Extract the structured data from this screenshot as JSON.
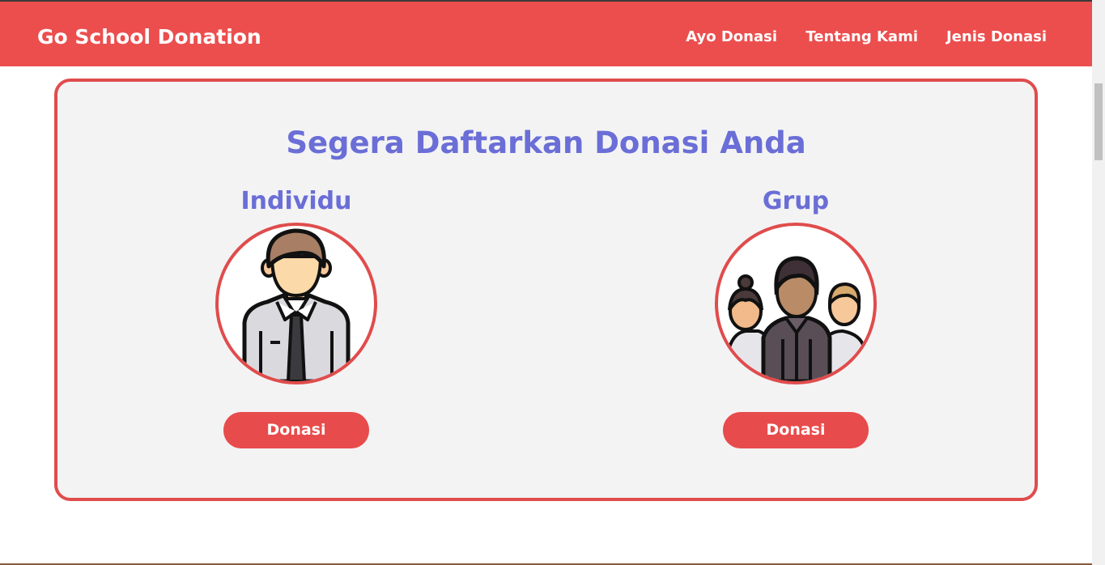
{
  "header": {
    "brand": "Go School Donation",
    "nav": [
      {
        "label": "Ayo Donasi"
      },
      {
        "label": "Tentang Kami"
      },
      {
        "label": "Jenis Donasi"
      }
    ]
  },
  "main": {
    "title": "Segera Daftarkan Donasi Anda",
    "options": [
      {
        "title": "Individu",
        "icon": "individual-person-icon",
        "button_label": "Donasi"
      },
      {
        "title": "Grup",
        "icon": "group-people-icon",
        "button_label": "Donasi"
      }
    ]
  },
  "colors": {
    "brand_red": "#ec4e4e",
    "accent_purple": "#6a6ed6",
    "card_bg": "#f3f3f4"
  }
}
